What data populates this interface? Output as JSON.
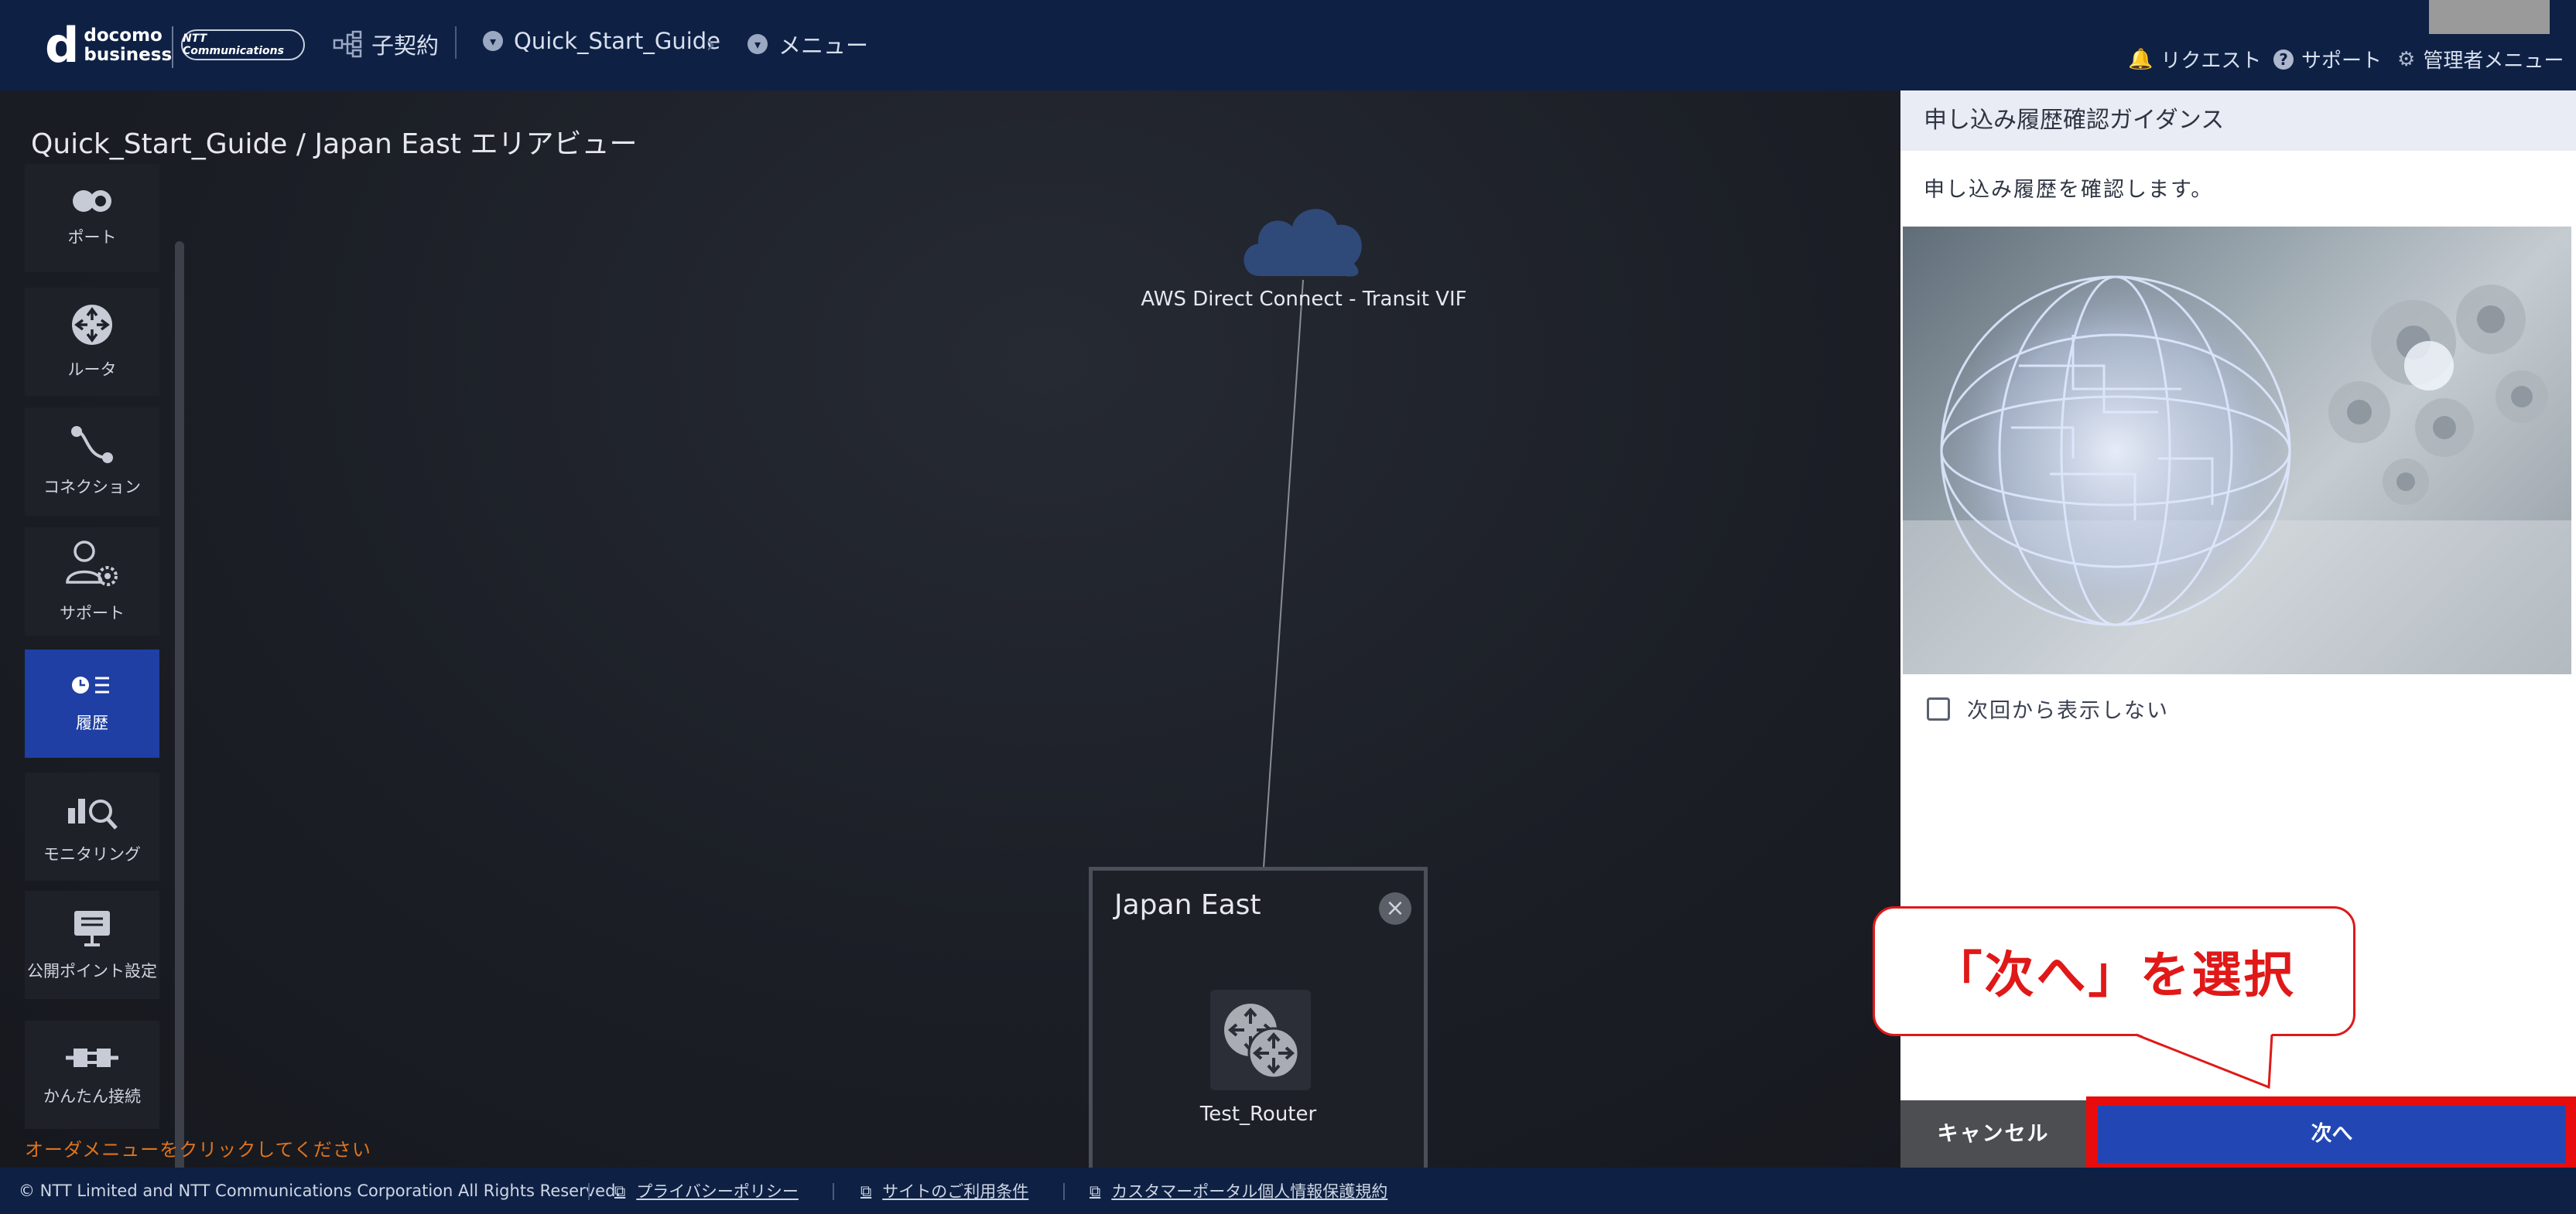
{
  "header": {
    "logo": {
      "mark": "d",
      "line1": "docomo",
      "line2": "business"
    },
    "ntt_logo": "NTT Communications",
    "breadcrumbs": [
      {
        "label": "子契約",
        "icon": "tree-icon"
      },
      {
        "label": "Quick_Start_Guide",
        "icon": "chevron-down-circle-icon"
      },
      {
        "label": "メニュー",
        "icon": "chevron-down-circle-icon"
      }
    ],
    "right_links": [
      {
        "label": "リクエスト",
        "icon": "bell-icon"
      },
      {
        "label": "サポート",
        "icon": "help-icon"
      },
      {
        "label": "管理者メニュー",
        "icon": "gear-icon"
      }
    ]
  },
  "canvas": {
    "title": "Quick_Start_Guide / Japan East エリアビュー",
    "sidebar": [
      {
        "label": "ポート",
        "icon": "port-icon"
      },
      {
        "label": "ルータ",
        "icon": "router-icon"
      },
      {
        "label": "コネクション",
        "icon": "connection-icon"
      },
      {
        "label": "サポート",
        "icon": "support-user-icon"
      },
      {
        "label": "履歴",
        "icon": "history-icon",
        "active": true
      },
      {
        "label": "モニタリング",
        "icon": "monitoring-icon"
      },
      {
        "label": "公開ポイント設定",
        "icon": "public-point-icon"
      },
      {
        "label": "かんたん接続",
        "icon": "easy-connect-icon"
      }
    ],
    "order_hint": "オーダメニューをクリックしてください",
    "cloud_label": "AWS Direct Connect - Transit VIF",
    "region": {
      "title": "Japan East",
      "router_label": "Test_Router"
    }
  },
  "panel": {
    "title": "申し込み履歴確認ガイダンス",
    "description": "申し込み履歴を確認します。",
    "checkbox_label": "次回から表示しない",
    "cancel_label": "キャンセル",
    "next_label": "次へ"
  },
  "callout": {
    "text": "「次へ」を選択"
  },
  "footer": {
    "copyright": "© NTT Limited and NTT Communications Corporation All Rights Reserved.",
    "links": [
      "プライバシーポリシー",
      "サイトのご利用条件",
      "カスタマーポータル個人情報保護規約"
    ]
  },
  "colors": {
    "header_bg": "#0e2145",
    "active_sidebar": "#1f3fa4",
    "next_button": "#2247b5",
    "highlight_red": "#e80c0c",
    "hint_orange": "#e0731c"
  }
}
